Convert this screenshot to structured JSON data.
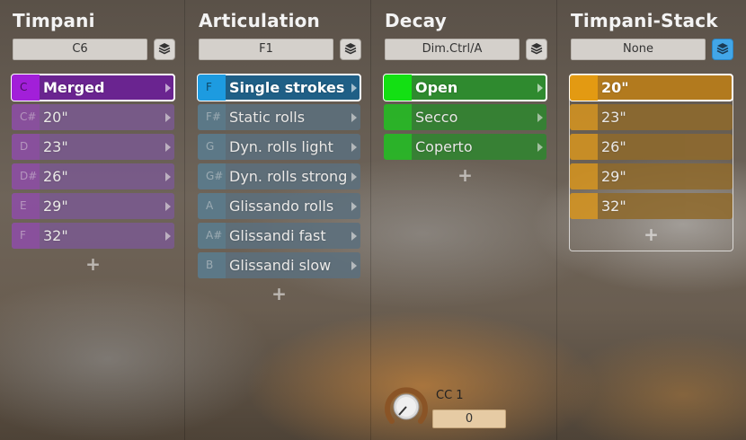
{
  "columns": [
    {
      "title": "Timpani",
      "dropdown": "C6",
      "stack_active": false,
      "colors": {
        "key": "#8e4ea8",
        "row": "#7a5a90",
        "sel_key": "#a21fd9",
        "sel_row": "#6a2490"
      },
      "rows": [
        {
          "key": "C",
          "label": "Merged",
          "selected": true
        },
        {
          "key": "C#",
          "label": "20\""
        },
        {
          "key": "D",
          "label": "23\""
        },
        {
          "key": "D#",
          "label": "26\""
        },
        {
          "key": "E",
          "label": "29\""
        },
        {
          "key": "F",
          "label": "32\""
        }
      ],
      "add_label": "+"
    },
    {
      "title": "Articulation",
      "dropdown": "F1",
      "stack_active": false,
      "colors": {
        "key": "#5a7d90",
        "row": "#5c707e",
        "sel_key": "#1d9be0",
        "sel_row": "#1f5f86"
      },
      "rows": [
        {
          "key": "F",
          "label": "Single strokes",
          "selected": true
        },
        {
          "key": "F#",
          "label": "Static rolls"
        },
        {
          "key": "G",
          "label": "Dyn. rolls light"
        },
        {
          "key": "G#",
          "label": "Dyn. rolls strong"
        },
        {
          "key": "A",
          "label": "Glissando rolls"
        },
        {
          "key": "A#",
          "label": "Glissandi fast"
        },
        {
          "key": "B",
          "label": "Glissandi slow"
        }
      ],
      "add_label": "+"
    },
    {
      "title": "Decay",
      "dropdown": "Dim.Ctrl/A",
      "stack_active": false,
      "colors": {
        "key": "#22c022",
        "row": "#2f862f",
        "sel_key": "#13e013",
        "sel_row": "#2f8a2f"
      },
      "rows": [
        {
          "key": "",
          "label": "Open",
          "selected": true
        },
        {
          "key": "",
          "label": "Secco"
        },
        {
          "key": "",
          "label": "Coperto"
        }
      ],
      "add_label": "+"
    },
    {
      "title": "Timpani-Stack",
      "dropdown": "None",
      "stack_active": true,
      "colors": {
        "key": "#d7951f",
        "row": "#8f6a2c",
        "sel_key": "#e39a12",
        "sel_row": "#b27a1e"
      },
      "rows": [
        {
          "key": "",
          "label": "20\"",
          "selected": true
        },
        {
          "key": "",
          "label": "23\""
        },
        {
          "key": "",
          "label": "26\""
        },
        {
          "key": "",
          "label": "29\""
        },
        {
          "key": "",
          "label": "32\""
        }
      ],
      "add_label": "+"
    }
  ],
  "controller": {
    "label": "CC 1",
    "value": "0",
    "knob_color": "#8a5426"
  }
}
